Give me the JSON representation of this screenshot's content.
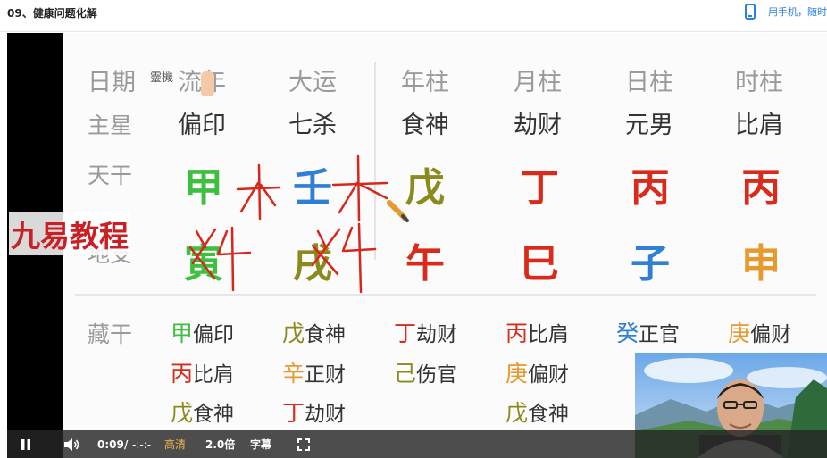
{
  "page": {
    "title": "09、健康问题化解",
    "mobile_hint": "用手机，随时"
  },
  "slide": {
    "logo_text": "靈機",
    "watermark": "九易教程",
    "headers": [
      "日期",
      "流年",
      "大运",
      "年柱",
      "月柱",
      "日柱",
      "时柱"
    ],
    "stars_label": "主星",
    "stars": [
      "偏印",
      "七杀",
      "食神",
      "劫财",
      "元男",
      "比肩"
    ],
    "tiangan_label": "天干",
    "tiangan": [
      "甲",
      "壬",
      "戊",
      "丁",
      "丙",
      "丙"
    ],
    "dizhi_label": "地支",
    "dizhi": [
      "寅",
      "戌",
      "午",
      "巳",
      "子",
      "申"
    ],
    "hidden_label": "藏干",
    "hidden_stems": [
      [
        {
          "stem": "甲",
          "god": "偏印"
        },
        {
          "stem": "丙",
          "god": "比肩"
        },
        {
          "stem": "戊",
          "god": "食神"
        }
      ],
      [
        {
          "stem": "戊",
          "god": "食神"
        },
        {
          "stem": "辛",
          "god": "正财"
        },
        {
          "stem": "丁",
          "god": "劫财"
        }
      ],
      [
        {
          "stem": "丁",
          "god": "劫财"
        },
        {
          "stem": "己",
          "god": "伤官"
        }
      ],
      [
        {
          "stem": "丙",
          "god": "比肩"
        },
        {
          "stem": "庚",
          "god": "偏财"
        },
        {
          "stem": "戊",
          "god": "食神"
        }
      ],
      [
        {
          "stem": "癸",
          "god": "正官"
        }
      ],
      [
        {
          "stem": "庚",
          "god": "偏财"
        }
      ]
    ]
  },
  "colors": {
    "wood": "#3fbf3f",
    "water": "#2f7fd6",
    "earth": "#8a8a1e",
    "fire": "#d92b1c",
    "metal": "#e69a2e",
    "ink": "#d8261c",
    "accent": "#2b7de9"
  },
  "player": {
    "current_time": "0:09",
    "separator": "/",
    "duration": "-:-:-",
    "quality": "高清",
    "speed": "2.0倍",
    "subtitles": "字幕",
    "play_state_icon": "pause-icon",
    "volume_icon": "volume-icon",
    "fullscreen_icon": "fullscreen-icon"
  }
}
